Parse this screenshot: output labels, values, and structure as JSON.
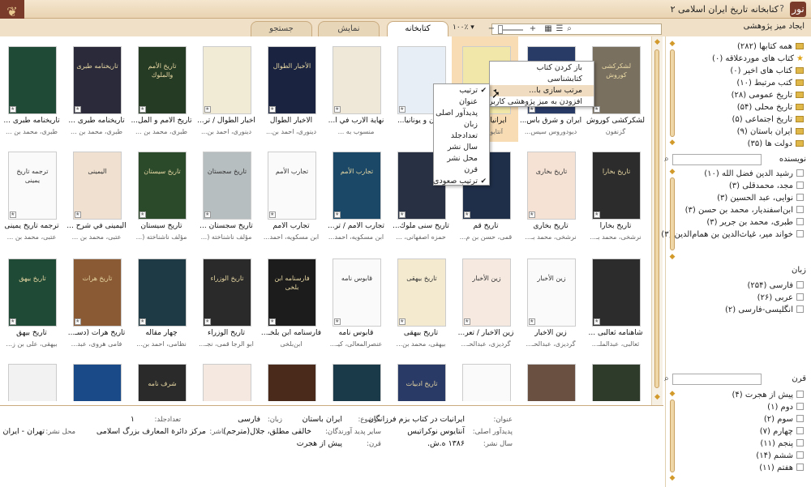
{
  "app": {
    "title": "کتابخانه تاریخ ایران اسلامی ۲",
    "logo": "نور"
  },
  "tabs": [
    {
      "label": "کتابخانه",
      "active": true
    },
    {
      "label": "نمایش",
      "active": false
    },
    {
      "label": "جستجو",
      "active": false
    }
  ],
  "toolbar": {
    "create_desk": "ایجاد میز پژوهشی",
    "zoom": "۱۰۰٪ ▾",
    "search_placeholder": ""
  },
  "grid": {
    "rows": [
      [
        {
          "title": "لشکرکشی کوروش",
          "author": "گزنفون",
          "bg": "#7a7060",
          "light": false
        },
        {
          "title": "ایران و شرق باس...",
          "author": "دیودوروس سیس...",
          "bg": "#283a66",
          "light": false
        },
        {
          "title": "ایرانیات در ...",
          "author": "آنتایوس نو...",
          "bg": "#f1e7a8",
          "light": true,
          "selected": true
        },
        {
          "title": "ایران و یونانیا...",
          "author": "",
          "bg": "#e8eef5",
          "light": true
        },
        {
          "title": "نهایة الأرب في أ...",
          "author": "منسوب به ...",
          "bg": "#efe8d8",
          "light": true
        },
        {
          "title": "الأخبار الطوال",
          "author": "دینوری، احمد بن...",
          "bg": "#1a2440",
          "light": false
        },
        {
          "title": "أخبار الطوال / تر...",
          "author": "دینوری، احمد بن...",
          "bg": "#f1ead4",
          "light": true
        },
        {
          "title": "تاریخ الأمم و المل...",
          "author": "طبری، محمد بن ...",
          "bg": "#263b24",
          "light": false
        },
        {
          "title": "تاریخنامه طبری ...",
          "author": "طبری، محمد بن ...",
          "bg": "#2a2a3a",
          "light": false
        },
        {
          "title": "تاریخنامه طبری ...",
          "author": "طبری، محمد بن ...",
          "bg": "#1f4a35",
          "light": false
        }
      ],
      [
        {
          "title": "تاریخ بخارا",
          "author": "نرشخی، محمد بـ...",
          "bg": "#2c2c2c",
          "light": false
        },
        {
          "title": "تاریخ بخاری",
          "author": "نرشخی، محمد بـ...",
          "bg": "#f5e2d4",
          "light": true
        },
        {
          "title": "تاریخ قم",
          "author": "قمی، حسن بن م...",
          "bg": "#1f2f4a",
          "light": false
        },
        {
          "title": "تاریخ سنی ملوك...",
          "author": "حمزه اصفهانی، ...",
          "bg": "#283044",
          "light": false
        },
        {
          "title": "تجارب الأمم / تر...",
          "author": "ابن مسکویه، احمد...",
          "bg": "#1a4866",
          "light": false
        },
        {
          "title": "تجارب الأمم",
          "author": "ابن مسکویه، احمد...",
          "bg": "#fafafa",
          "light": true
        },
        {
          "title": "تاریخ سجستان ...",
          "author": "مؤلف ناشناخته (...",
          "bg": "#b7bec0",
          "light": true
        },
        {
          "title": "تاریخ سیستان",
          "author": "مؤلف ناشناخته (...",
          "bg": "#2a4a2a",
          "light": false
        },
        {
          "title": "الیمینی في شرح ...",
          "author": "عتبی، محمد بن ...",
          "bg": "#efe0d0",
          "light": true
        },
        {
          "title": "ترجمه تاریخ یمینی",
          "author": "عتبی، محمد بن ...",
          "bg": "#fafafa",
          "light": true
        }
      ],
      [
        {
          "title": "شاهنامه ثعالبی ...",
          "author": "ثعالبی، عبدالملـ...",
          "bg": "#2c2c2c",
          "light": false
        },
        {
          "title": "زین الأخبار",
          "author": "گردیزی، عبدالحـ...",
          "bg": "#fafafa",
          "light": true
        },
        {
          "title": "زین الأخبار / تعر...",
          "author": "گردیزی، عبدالحـ...",
          "bg": "#f5e9e0",
          "light": true
        },
        {
          "title": "تاریخ بیهقی",
          "author": "بیهقی، محمد بن...",
          "bg": "#f4ead0",
          "light": true
        },
        {
          "title": "قابوس نامه",
          "author": "عنصرالمعالی، کیـ...",
          "bg": "#fafafa",
          "light": true
        },
        {
          "title": "فارسنامه ابن بلخـ...",
          "author": "ابن‌بلخی",
          "bg": "#1c1c1c",
          "light": false
        },
        {
          "title": "تاریخ الوزراء",
          "author": "ابو الرجا قمی، نجـ...",
          "bg": "#2a2a2a",
          "light": false
        },
        {
          "title": "چهار مقاله",
          "author": "نظامی، احمد بن...",
          "bg": "#1e3a44",
          "light": false
        },
        {
          "title": "تاریخ هرات (دسـ...",
          "author": "فامی هروی، عبد...",
          "bg": "#8a5a34",
          "light": false
        },
        {
          "title": "تاریخ بیهق",
          "author": "بیهقی، علی بن ز...",
          "bg": "#1f4a35",
          "light": false
        }
      ],
      [
        {
          "title": "",
          "author": "",
          "bg": "#2e3a2a",
          "light": false
        },
        {
          "title": "",
          "author": "",
          "bg": "#6a5040",
          "light": false
        },
        {
          "title": "",
          "author": "",
          "bg": "#fafafa",
          "light": true
        },
        {
          "title": "",
          "author": "",
          "bg": "#2a3a66",
          "light": false
        },
        {
          "title": "",
          "author": "",
          "bg": "#1a3a4a",
          "light": false
        },
        {
          "title": "",
          "author": "",
          "bg": "#4a2a1a",
          "light": false
        },
        {
          "title": "",
          "author": "",
          "bg": "#f4e8e0",
          "light": true
        },
        {
          "title": "",
          "author": "",
          "bg": "#2a2a2a",
          "light": false
        },
        {
          "title": "",
          "author": "",
          "bg": "#1a4a88",
          "light": false
        },
        {
          "title": "",
          "author": "",
          "bg": "#f2f2f2",
          "light": true
        }
      ]
    ]
  },
  "cover_texts": {
    "r0c0": "لشکرکشی کوروش",
    "r0c5": "الأخبار الطوال",
    "r0c7": "تاريخ الأمم والملوك",
    "r0c8": "تاریخنامه طبری",
    "r1c0": "تاریخ بخارا",
    "r1c1": "تاریخ بخاری",
    "r1c4": "تجارب الأمم",
    "r1c5": "تجارب الأمم",
    "r1c6": "تاریخ سجستان",
    "r1c7": "تاریخ سیستان",
    "r1c8": "الیمینی",
    "r1c9": "ترجمه تاریخ یمینی",
    "r2c1": "زین الأخبار",
    "r2c2": "زین الأخبار",
    "r2c3": "تاریخ بیهقی",
    "r2c4": "قابوس نامه",
    "r2c5": "فارسنامه ابن بلخی",
    "r2c6": "تاریخ الوزراء",
    "r2c8": "تاریخ هرات",
    "r2c9": "تاریخ بیهق",
    "r3c3": "تاریخ ادبیات",
    "r3c7": "شرف نامه"
  },
  "context_menu": {
    "items": [
      "باز کردن کتاب",
      "کتابشناسی",
      "مرتب سازی با...",
      "افزودن به میز پژوهشی کاربر"
    ],
    "sort_submenu": {
      "items": [
        "ترتیب",
        "عنوان",
        "پدیدآور اصلی",
        "زبان",
        "تعدادجلد",
        "سال نشر",
        "محل نشر",
        "قرن",
        "ترتیب صعودی"
      ]
    }
  },
  "sidebar": {
    "collections": [
      {
        "label": "همه کتابها (۲۸۲)",
        "icon": "folder"
      },
      {
        "label": "کتاب های موردعلاقه (۰)",
        "icon": "star"
      },
      {
        "label": "کتاب های اخیر (۰)",
        "icon": "folder"
      },
      {
        "label": "کتب مرتبط (۱۰)",
        "icon": "link"
      },
      {
        "label": "تاریخ عمومی (۲۸)",
        "icon": "folder"
      },
      {
        "label": "تاریخ محلی (۵۴)",
        "icon": "folder"
      },
      {
        "label": "تاریخ اجتماعی (۵)",
        "icon": "folder"
      },
      {
        "label": "ایران باستان (۹)",
        "icon": "folder"
      },
      {
        "label": "دولت ها (۳۵)",
        "icon": "folder"
      }
    ],
    "author_header": "نویسنده",
    "authors": [
      "رشید الدین فضل الله (۱۰)",
      "مجد، محمدقلی (۳)",
      "نوایی، عبد الحسین (۳)",
      "ابن‌اسفندیار، محمد بن حسن (۳)",
      "طبری، محمد بن جریر (۳)",
      "خواند میر، غیاث‌الدین بن همام‌الدین (۳)"
    ],
    "language_header": "زبان",
    "languages": [
      "فارسی (۲۵۴)",
      "عربی (۲۶)",
      "انگلیسی-فارسی (۲)"
    ],
    "century_header": "قرن",
    "centuries": [
      "پیش از هجرت (۴)",
      "دوم (۱)",
      "سوم (۲)",
      "چهارم (۷)",
      "پنجم (۱۱)",
      "ششم (۱۴)",
      "هفتم (۱۱)"
    ]
  },
  "details": {
    "title_key": "عنوان:",
    "title_val": "ایرانیات در کتاب بزم فرزانگان",
    "subject_key": "موضوع:",
    "subject_val": "ایران باستان",
    "author_key": "پدیدآور اصلی:",
    "author_val": "آنتایوس نوکراتیس",
    "other_key": "سایر پدید آورندگان:",
    "other_val": "خالقی مطلق، جلال(مترجم)",
    "year_key": "سال نشر:",
    "year_val": "۱۳۸۶ ه.ش.",
    "century_key": "قرن:",
    "century_val": "پیش از هجرت",
    "lang_key": "زبان:",
    "lang_val": "فارسی",
    "publisher_key": "ناشر:",
    "publisher_val": "مرکز دائرة المعارف بزرگ اسلامی",
    "vols_key": "تعدادجلد:",
    "vols_val": "۱",
    "place_key": "محل نشر:",
    "place_val": "تهران - ایران"
  }
}
